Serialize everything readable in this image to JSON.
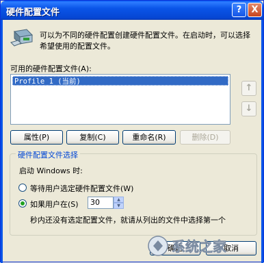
{
  "dialog": {
    "title": "硬件配置文件",
    "help_button": "?",
    "close_button": "X",
    "description": "可以为不同的硬件配置创建硬件配置文件。在启动时，可以选择希望使用的配置文件。"
  },
  "profiles": {
    "label": "可用的硬件配置文件(A):",
    "items": [
      "Profile 1 (当前)"
    ],
    "selected_index": 0,
    "move_up_arrow": "↑",
    "move_down_arrow": "↓"
  },
  "actions": {
    "properties": "属性(P)",
    "copy": "复制(C)",
    "rename": "重命名(R)",
    "delete": "删除(D)"
  },
  "selection_group": {
    "title": "硬件配置文件选择",
    "startup_label": "启动 Windows 时:",
    "wait_option": "等待用户选定硬件配置文件(W)",
    "timeout_option": "如果用户在(S)",
    "timeout_value": "30",
    "timeout_suffix": "秒内还没有选定配置文件，就请从列出的文件中选择第一个",
    "selected_option": "timeout"
  },
  "footer": {
    "ok": "确定",
    "cancel": "取消"
  },
  "watermark": {
    "text": "系统之家"
  },
  "colors": {
    "titlebar": "#0a55e8",
    "selection": "#316ac5",
    "dialog_bg": "#ece9d8",
    "radio_dot": "#21a121"
  }
}
